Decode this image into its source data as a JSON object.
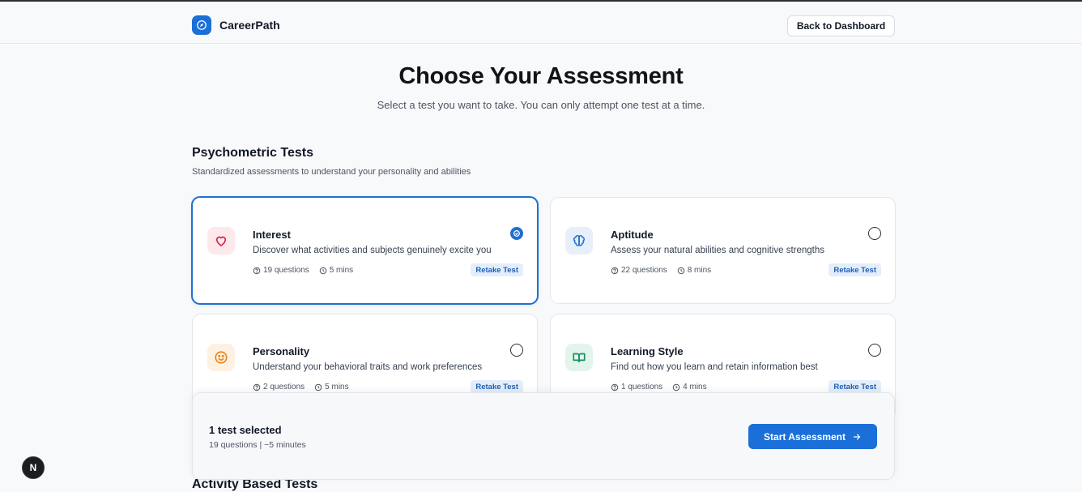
{
  "header": {
    "brand_name": "CareerPath",
    "back_label": "Back to Dashboard"
  },
  "page": {
    "title": "Choose Your Assessment",
    "subtitle": "Select a test you want to take. You can only attempt one test at a time."
  },
  "psychometric": {
    "title": "Psychometric Tests",
    "description": "Standardized assessments to understand your personality and abilities",
    "cards": [
      {
        "title": "Interest",
        "description": "Discover what activities and subjects genuinely excite you",
        "questions": "19 questions",
        "duration": "5 mins",
        "action": "Retake Test",
        "icon": "heart-icon",
        "accent": "#e11d48",
        "icon_bg": "#fde8ec",
        "selected": true
      },
      {
        "title": "Aptitude",
        "description": "Assess your natural abilities and cognitive strengths",
        "questions": "22 questions",
        "duration": "8 mins",
        "action": "Retake Test",
        "icon": "brain-icon",
        "accent": "#1f6fd0",
        "icon_bg": "#e7effb",
        "selected": false
      },
      {
        "title": "Personality",
        "description": "Understand your behavioral traits and work preferences",
        "questions": "2 questions",
        "duration": "5 mins",
        "action": "Retake Test",
        "icon": "smile-icon",
        "accent": "#e8841a",
        "icon_bg": "#fdf1e2",
        "selected": false
      },
      {
        "title": "Learning Style",
        "description": "Find out how you learn and retain information best",
        "questions": "1 questions",
        "duration": "4 mins",
        "action": "Retake Test",
        "icon": "book-open-icon",
        "accent": "#15915d",
        "icon_bg": "#e3f4ec",
        "selected": false
      }
    ]
  },
  "selection": {
    "count_label": "1 test selected",
    "summary": "19 questions | ~5 minutes",
    "start_label": "Start Assessment"
  },
  "next_section": {
    "title": "Activity Based Tests"
  },
  "overlay_badge": "N",
  "colors": {
    "primary": "#1a6fd8",
    "retake_bg": "#e4eefb",
    "retake_text": "#1f5fb8"
  }
}
